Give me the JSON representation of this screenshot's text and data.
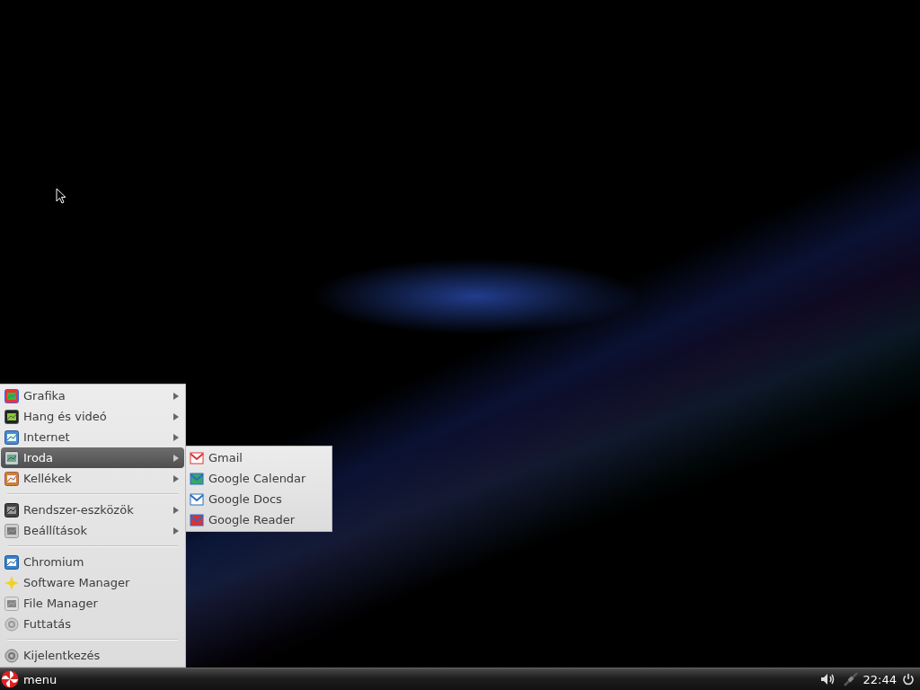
{
  "menu": {
    "items": [
      {
        "kind": "item",
        "label": "Grafika",
        "has_submenu": true,
        "selected": false
      },
      {
        "kind": "item",
        "label": "Hang és videó",
        "has_submenu": true,
        "selected": false
      },
      {
        "kind": "item",
        "label": "Internet",
        "has_submenu": true,
        "selected": false
      },
      {
        "kind": "item",
        "label": "Iroda",
        "has_submenu": true,
        "selected": true,
        "submenu": [
          {
            "label": "Gmail"
          },
          {
            "label": "Google Calendar"
          },
          {
            "label": "Google Docs"
          },
          {
            "label": "Google Reader"
          }
        ]
      },
      {
        "kind": "item",
        "label": "Kellékek",
        "has_submenu": true,
        "selected": false
      },
      {
        "kind": "separator"
      },
      {
        "kind": "item",
        "label": "Rendszer-eszközök",
        "has_submenu": true,
        "selected": false
      },
      {
        "kind": "item",
        "label": "Beállítások",
        "has_submenu": true,
        "selected": false
      },
      {
        "kind": "separator"
      },
      {
        "kind": "item",
        "label": "Chromium",
        "has_submenu": false,
        "selected": false
      },
      {
        "kind": "item",
        "label": "Software Manager",
        "has_submenu": false,
        "selected": false
      },
      {
        "kind": "item",
        "label": "File Manager",
        "has_submenu": false,
        "selected": false
      },
      {
        "kind": "item",
        "label": "Futtatás",
        "has_submenu": false,
        "selected": false
      },
      {
        "kind": "separator"
      },
      {
        "kind": "item",
        "label": "Kijelentkezés",
        "has_submenu": false,
        "selected": false
      }
    ]
  },
  "taskbar": {
    "menu_label": "menu",
    "clock": "22:44"
  }
}
